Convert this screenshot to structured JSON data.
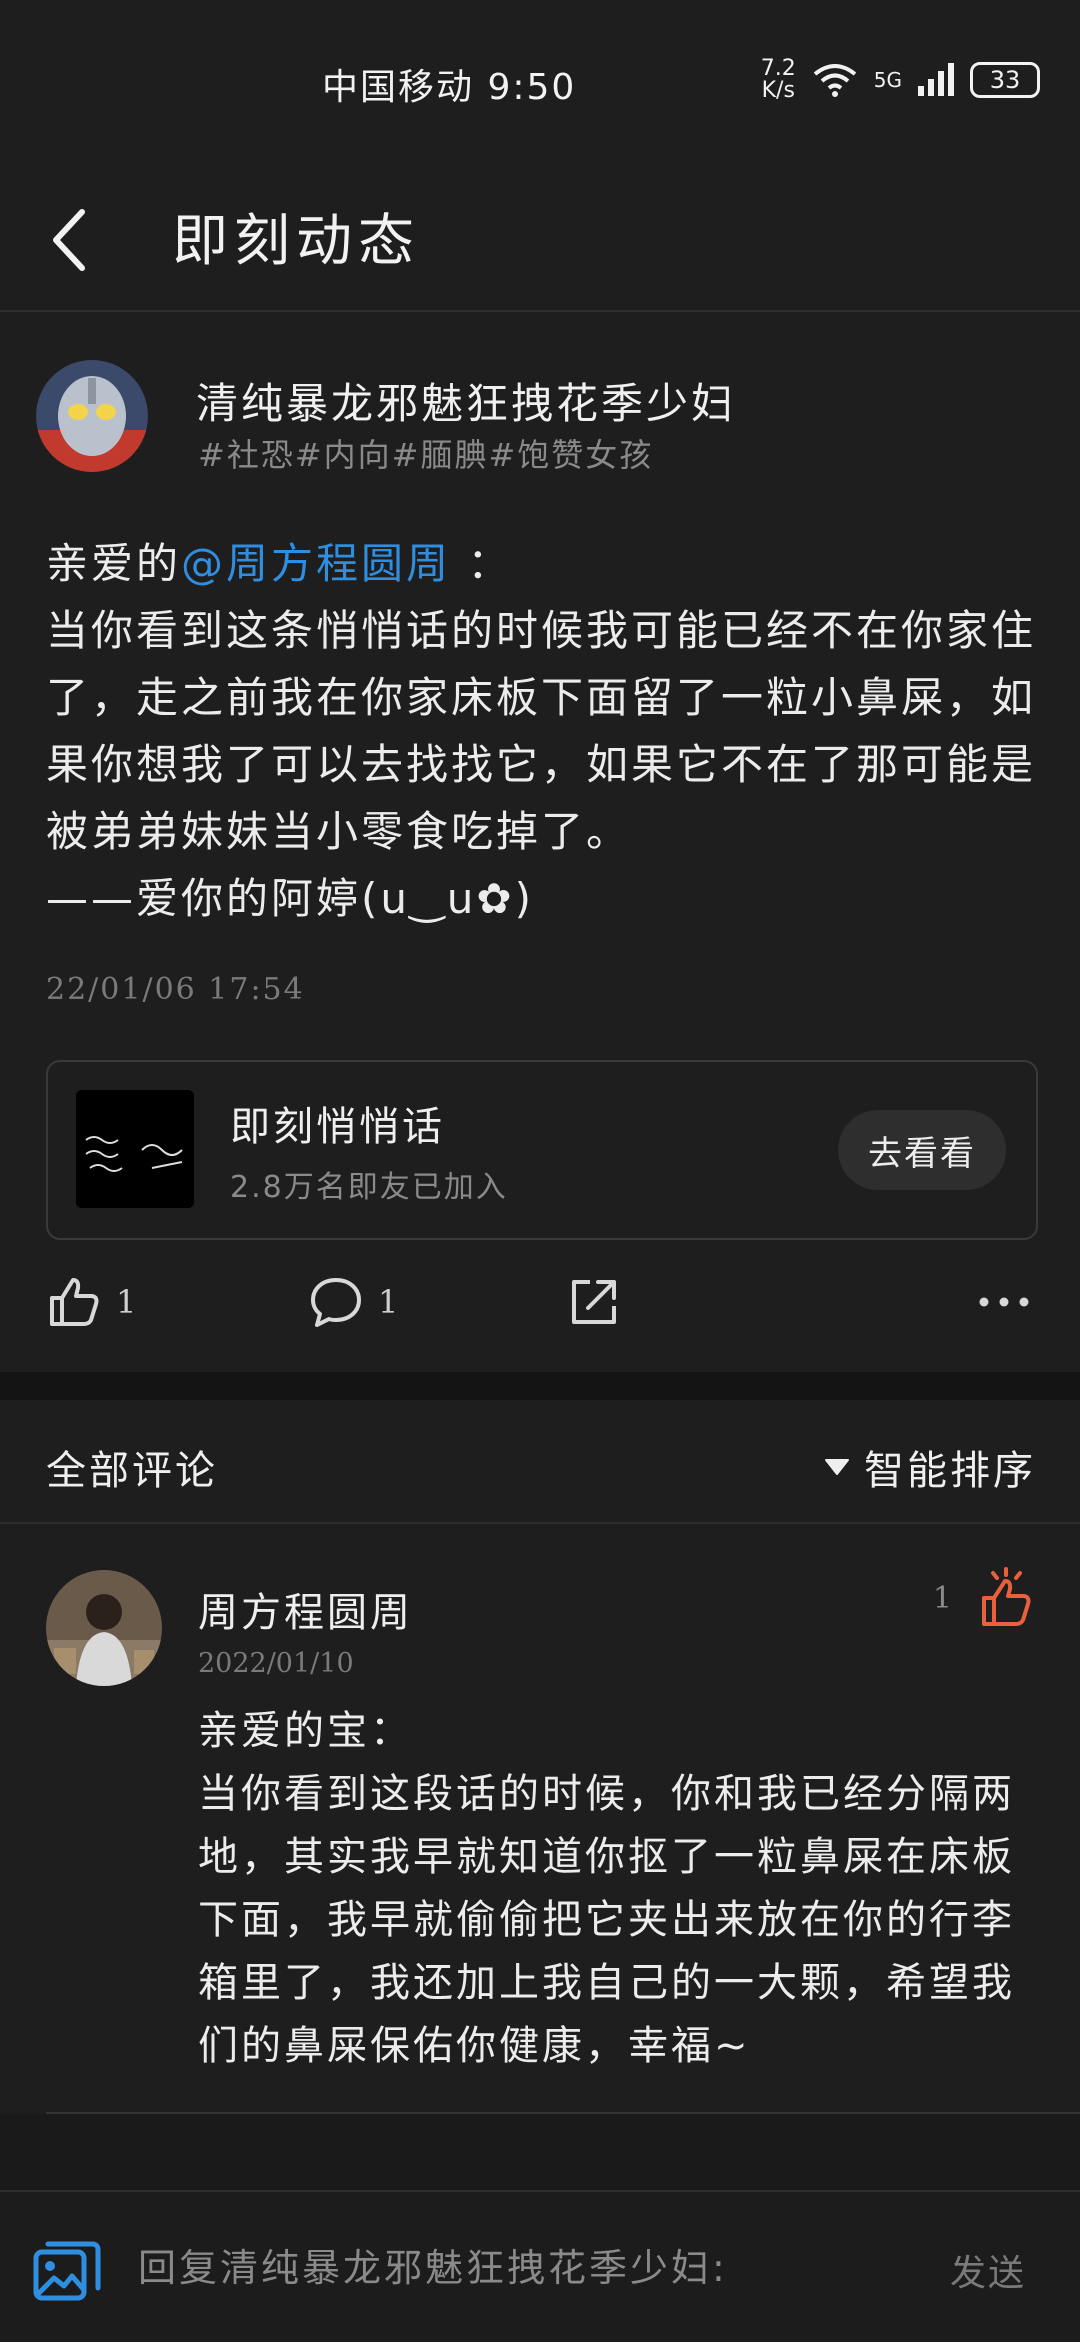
{
  "status_bar": {
    "carrier_time": "中国移动 9:50",
    "net_speed_value": "7.2",
    "net_speed_unit": "K/s",
    "network": "5G",
    "battery": "33"
  },
  "header": {
    "title": "即刻动态"
  },
  "post": {
    "author": "清纯暴龙邪魅狂拽花季少妇",
    "tags": "#社恐#内向#腼腆#饱赞女孩",
    "content_prefix": "亲爱的",
    "mention": "@周方程圆周",
    "content_colon": " ：",
    "content_body": "当你看到这条悄悄话的时候我可能已经不在你家住了，走之前我在你家床板下面留了一粒小鼻屎，如果你想我了可以去找找它，如果它不在了那可能是被弟弟妹妹当小零食吃掉了。\n——爱你的阿婷(u‿u✿)",
    "timestamp": "22/01/06 17:54",
    "topic": {
      "name": "即刻悄悄话",
      "members": "2.8万名即友已加入",
      "button": "去看看"
    },
    "actions": {
      "likes": "1",
      "comments": "1"
    }
  },
  "comments_section": {
    "title": "全部评论",
    "sort": "智能排序",
    "items": [
      {
        "author": "周方程圆周",
        "date": "2022/01/10",
        "likes": "1",
        "body": "亲爱的宝：\n当你看到这段话的时候，你和我已经分隔两地，其实我早就知道你抠了一粒鼻屎在床板下面，我早就偷偷把它夹出来放在你的行李箱里了，我还加上我自己的一大颗，希望我们的鼻屎保佑你健康，幸福~"
      }
    ]
  },
  "reply_bar": {
    "placeholder": "回复清纯暴龙邪魅狂拽花季少妇:",
    "send": "发送"
  },
  "colors": {
    "background": "#1e1e1e",
    "mention": "#2f8ee0",
    "liked": "#e8603c"
  },
  "icons": [
    "back-icon",
    "wifi-icon",
    "signal-icon",
    "thumbs-up-icon",
    "comment-icon",
    "share-icon",
    "more-icon",
    "sort-triangle-icon",
    "image-icon"
  ]
}
